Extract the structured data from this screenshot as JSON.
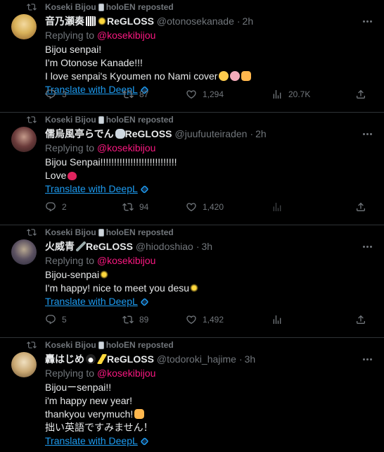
{
  "posts": [
    {
      "repost_by": "Koseki Bijou",
      "repost_suffix": "holoEN reposted",
      "name": "音乃瀬奏",
      "name_suffix": "ReGLOSS",
      "handle": "@otonosekanade",
      "dot": "·",
      "time": "2h",
      "replying_label": "Replying to",
      "replying_to": "@kosekibijou",
      "lines": [
        "Bijou senpai!",
        "I'm Otonose Kanade!!!",
        "I love senpai's Kyoumen no Nami cover"
      ],
      "translate": "Translate with DeepL",
      "replies": "3",
      "reposts": "87",
      "likes": "1,294",
      "views": "20.7K",
      "avatar_color": "#d9b25a"
    },
    {
      "repost_by": "Koseki Bijou",
      "repost_suffix": "holoEN reposted",
      "name": "儒烏風亭らでん",
      "name_suffix": "ReGLOSS",
      "handle": "@juufuuteiraden",
      "dot": "·",
      "time": "2h",
      "replying_label": "Replying to",
      "replying_to": "@kosekibijou",
      "lines": [
        "Bijou Senpai!!!!!!!!!!!!!!!!!!!!!!!!!!!!",
        "Love"
      ],
      "translate": "Translate with DeepL",
      "replies": "2",
      "reposts": "94",
      "likes": "1,420",
      "views": "",
      "avatar_color": "#5a3a3a"
    },
    {
      "repost_by": "Koseki Bijou",
      "repost_suffix": "holoEN reposted",
      "name": "火威青",
      "name_suffix": "ReGLOSS",
      "handle": "@hiodoshiao",
      "dot": "·",
      "time": "3h",
      "replying_label": "Replying to",
      "replying_to": "@kosekibijou",
      "lines": [
        "Bijou-senpai",
        "I'm happy! nice to meet you desu"
      ],
      "translate": "Translate with DeepL",
      "replies": "5",
      "reposts": "89",
      "likes": "1,492",
      "views": "",
      "avatar_color": "#3a4a6a"
    },
    {
      "repost_by": "Koseki Bijou",
      "repost_suffix": "holoEN reposted",
      "name": "轟はじめ",
      "name_suffix": "ReGLOSS",
      "handle": "@todoroki_hajime",
      "dot": "·",
      "time": "3h",
      "replying_label": "Replying to",
      "replying_to": "@kosekibijou",
      "lines": [
        "Bijouーsenpai!!",
        "i'm happy new year!",
        "thankyou verymuch!",
        "拙い英語ですみません！"
      ],
      "translate": "Translate with DeepL",
      "replies": "",
      "reposts": "",
      "likes": "",
      "views": "",
      "avatar_color": "#c9a873"
    }
  ]
}
